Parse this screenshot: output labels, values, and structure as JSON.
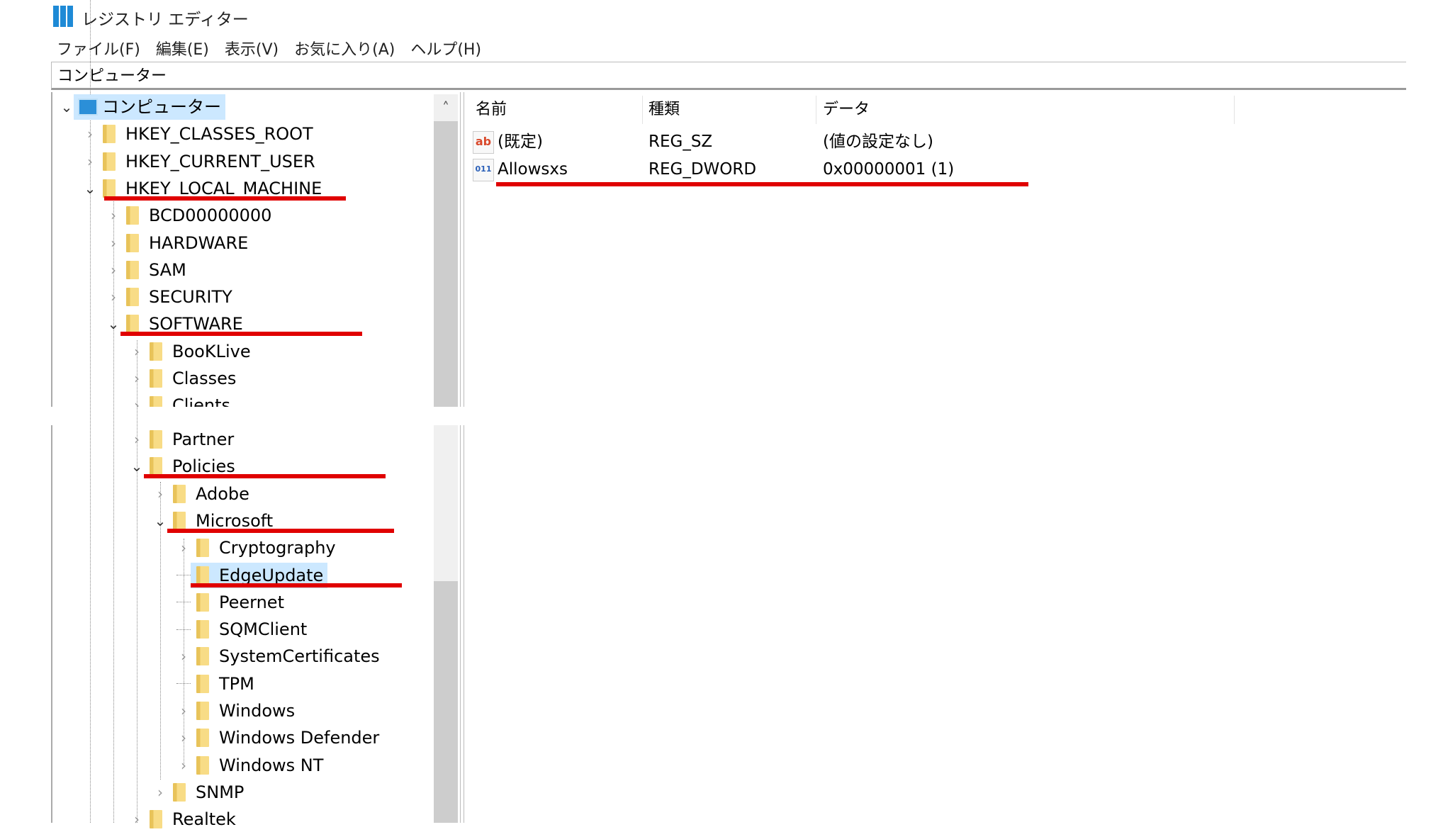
{
  "window": {
    "title": "レジストリ エディター",
    "icon": "registry-editor-icon"
  },
  "menu": [
    "ファイル(F)",
    "編集(E)",
    "表示(V)",
    "お気に入り(A)",
    "ヘルプ(H)"
  ],
  "address": "コンピューター",
  "tree_top": [
    {
      "label": "コンピューター",
      "level": 0,
      "state": "open",
      "selected": true,
      "icon": "computer-icon"
    },
    {
      "label": "HKEY_CLASSES_ROOT",
      "level": 1,
      "state": "closed"
    },
    {
      "label": "HKEY_CURRENT_USER",
      "level": 1,
      "state": "closed"
    },
    {
      "label": "HKEY_LOCAL_MACHINE",
      "level": 1,
      "state": "open",
      "highlighted": true
    },
    {
      "label": "BCD00000000",
      "level": 2,
      "state": "closed"
    },
    {
      "label": "HARDWARE",
      "level": 2,
      "state": "closed"
    },
    {
      "label": "SAM",
      "level": 2,
      "state": "closed"
    },
    {
      "label": "SECURITY",
      "level": 2,
      "state": "closed"
    },
    {
      "label": "SOFTWARE",
      "level": 2,
      "state": "open",
      "highlighted": true
    },
    {
      "label": "BooKLive",
      "level": 3,
      "state": "closed"
    },
    {
      "label": "Classes",
      "level": 3,
      "state": "closed"
    },
    {
      "label": "Clients",
      "level": 3,
      "state": "closed"
    }
  ],
  "tree_bottom": [
    {
      "label": "Partner",
      "level": 3,
      "state": "closed"
    },
    {
      "label": "Policies",
      "level": 3,
      "state": "open",
      "highlighted": true
    },
    {
      "label": "Adobe",
      "level": 4,
      "state": "closed"
    },
    {
      "label": "Microsoft",
      "level": 4,
      "state": "open",
      "highlighted": true
    },
    {
      "label": "Cryptography",
      "level": 5,
      "state": "closed"
    },
    {
      "label": "EdgeUpdate",
      "level": 5,
      "state": "leaf",
      "selected": true,
      "highlighted": true
    },
    {
      "label": "Peernet",
      "level": 5,
      "state": "leaf"
    },
    {
      "label": "SQMClient",
      "level": 5,
      "state": "leaf"
    },
    {
      "label": "SystemCertificates",
      "level": 5,
      "state": "closed"
    },
    {
      "label": "TPM",
      "level": 5,
      "state": "leaf"
    },
    {
      "label": "Windows",
      "level": 5,
      "state": "closed"
    },
    {
      "label": "Windows Defender",
      "level": 5,
      "state": "closed"
    },
    {
      "label": "Windows NT",
      "level": 5,
      "state": "closed"
    },
    {
      "label": "SNMP",
      "level": 4,
      "state": "closed"
    },
    {
      "label": "Realtek",
      "level": 3,
      "state": "closed"
    }
  ],
  "values": {
    "columns": [
      "名前",
      "種類",
      "データ"
    ],
    "rows": [
      {
        "name": "(既定)",
        "type": "REG_SZ",
        "data": "(値の設定なし)",
        "icon": "string-value-icon",
        "glyph": "ab",
        "color": "#d9482b"
      },
      {
        "name": "Allowsxs",
        "type": "REG_DWORD",
        "data": "0x00000001 (1)",
        "icon": "binary-value-icon",
        "glyph": "011",
        "color": "#2a5fb8",
        "highlighted": true
      }
    ]
  },
  "colors": {
    "highlight": "#e00000",
    "selection": "#cce8ff"
  }
}
